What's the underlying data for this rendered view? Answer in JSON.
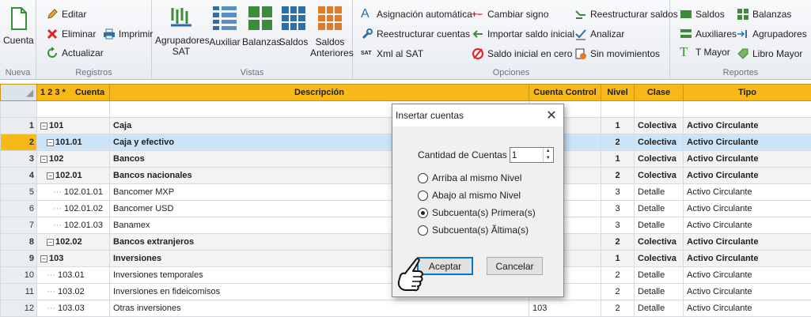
{
  "ribbon": {
    "nueva": {
      "label": "Nueva",
      "cuenta_label": "Cuenta"
    },
    "registros": {
      "label": "Registros",
      "editar": "Editar",
      "eliminar": "Eliminar",
      "actualizar": "Actualizar",
      "imprimir": "Imprimir"
    },
    "vistas": {
      "label": "Vistas",
      "agrupadores_sat": "Agrupadores SAT",
      "auxiliar": "Auxiliar",
      "balanzas": "Balanzas",
      "saldos": "Saldos",
      "saldos_anteriores": "Saldos Anteriores"
    },
    "opciones": {
      "label": "Opciones",
      "asignacion": "Asignación automática",
      "reestructurar_cuentas": "Reestructurar cuentas",
      "xml_sat": "Xml al SAT",
      "sat_badge": "SAT",
      "cambiar_signo": "Cambiar signo",
      "importar": "Importar saldo inicial",
      "saldo_cero": "Saldo inicial en cero",
      "reestructurar_saldos": "Reestructurar saldos",
      "analizar": "Analizar",
      "sin_movimientos": "Sin movimientos"
    },
    "reportes": {
      "label": "Reportes",
      "saldos": "Saldos",
      "auxiliares": "Auxiliares",
      "t_mayor": "T Mayor",
      "balanzas": "Balanzas",
      "agrupadores": "Agrupadores",
      "libro_mayor": "Libro Mayor"
    }
  },
  "grid": {
    "headers": {
      "levels": "1 2 3 *",
      "cuenta": "Cuenta",
      "descripcion": "Descripción",
      "cuenta_control": "Cuenta Control",
      "nivel": "Nivel",
      "clase": "Clase",
      "tipo": "Tipo"
    },
    "rows": [
      {
        "n": "1",
        "cuenta": "101",
        "desc": "Caja",
        "control": "",
        "nivel": "1",
        "clase": "Colectiva",
        "tipo": "Activo Circulante"
      },
      {
        "n": "2",
        "cuenta": "101.01",
        "desc": "Caja y efectivo",
        "control": "",
        "nivel": "2",
        "clase": "Colectiva",
        "tipo": "Activo Circulante"
      },
      {
        "n": "3",
        "cuenta": "102",
        "desc": "Bancos",
        "control": "",
        "nivel": "1",
        "clase": "Colectiva",
        "tipo": "Activo Circulante"
      },
      {
        "n": "4",
        "cuenta": "102.01",
        "desc": "Bancos nacionales",
        "control": "",
        "nivel": "2",
        "clase": "Colectiva",
        "tipo": "Activo Circulante"
      },
      {
        "n": "5",
        "cuenta": "102.01.01",
        "desc": "Bancomer MXP",
        "control": "",
        "nivel": "3",
        "clase": "Detalle",
        "tipo": "Activo Circulante"
      },
      {
        "n": "6",
        "cuenta": "102.01.02",
        "desc": "Bancomer USD",
        "control": "",
        "nivel": "3",
        "clase": "Detalle",
        "tipo": "Activo Circulante"
      },
      {
        "n": "7",
        "cuenta": "102.01.03",
        "desc": "Banamex",
        "control": "",
        "nivel": "3",
        "clase": "Detalle",
        "tipo": "Activo Circulante"
      },
      {
        "n": "8",
        "cuenta": "102.02",
        "desc": "Bancos extranjeros",
        "control": "",
        "nivel": "2",
        "clase": "Colectiva",
        "tipo": "Activo Circulante"
      },
      {
        "n": "9",
        "cuenta": "103",
        "desc": "Inversiones",
        "control": "",
        "nivel": "1",
        "clase": "Colectiva",
        "tipo": "Activo Circulante"
      },
      {
        "n": "10",
        "cuenta": "103.01",
        "desc": "Inversiones temporales",
        "control": "",
        "nivel": "2",
        "clase": "Detalle",
        "tipo": "Activo Circulante"
      },
      {
        "n": "11",
        "cuenta": "103.02",
        "desc": "Inversiones en fideicomisos",
        "control": "",
        "nivel": "2",
        "clase": "Detalle",
        "tipo": "Activo Circulante"
      },
      {
        "n": "12",
        "cuenta": "103.03",
        "desc": "Otras inversiones",
        "control": "103",
        "nivel": "2",
        "clase": "Detalle",
        "tipo": "Activo Circulante"
      }
    ]
  },
  "dialog": {
    "title": "Insertar cuentas",
    "cantidad_label": "Cantidad de Cuentas",
    "cantidad_value": "1",
    "options": [
      "Arriba al mismo Nivel",
      "Abajo al mismo Nivel",
      "Subcuenta(s) Primera(s)",
      "Subcuenta(s) Ãltima(s)"
    ],
    "selected_option": 2,
    "accept": "Aceptar",
    "cancel": "Cancelar"
  },
  "colors": {
    "header": "#f7b918",
    "selection": "#cce4f7",
    "accent": "#0078d7"
  }
}
